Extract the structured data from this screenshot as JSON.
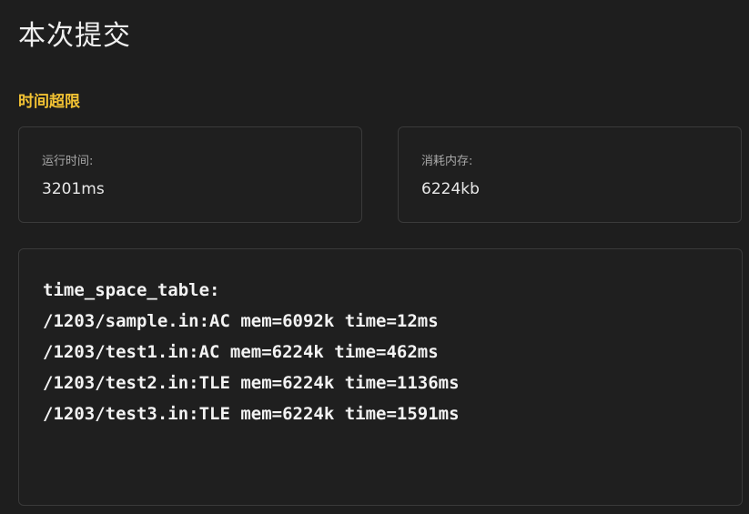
{
  "header": {
    "title": "本次提交"
  },
  "submission": {
    "status": "时间超限",
    "status_color": "#f2c233"
  },
  "stats": {
    "runtime": {
      "label": "运行时间:",
      "value": "3201ms"
    },
    "memory": {
      "label": "消耗内存:",
      "value": "6224kb"
    }
  },
  "log": {
    "lines": [
      "time_space_table:",
      "/1203/sample.in:AC mem=6092k time=12ms",
      "/1203/test1.in:AC mem=6224k time=462ms",
      "/1203/test2.in:TLE mem=6224k time=1136ms",
      "/1203/test3.in:TLE mem=6224k time=1591ms"
    ]
  }
}
